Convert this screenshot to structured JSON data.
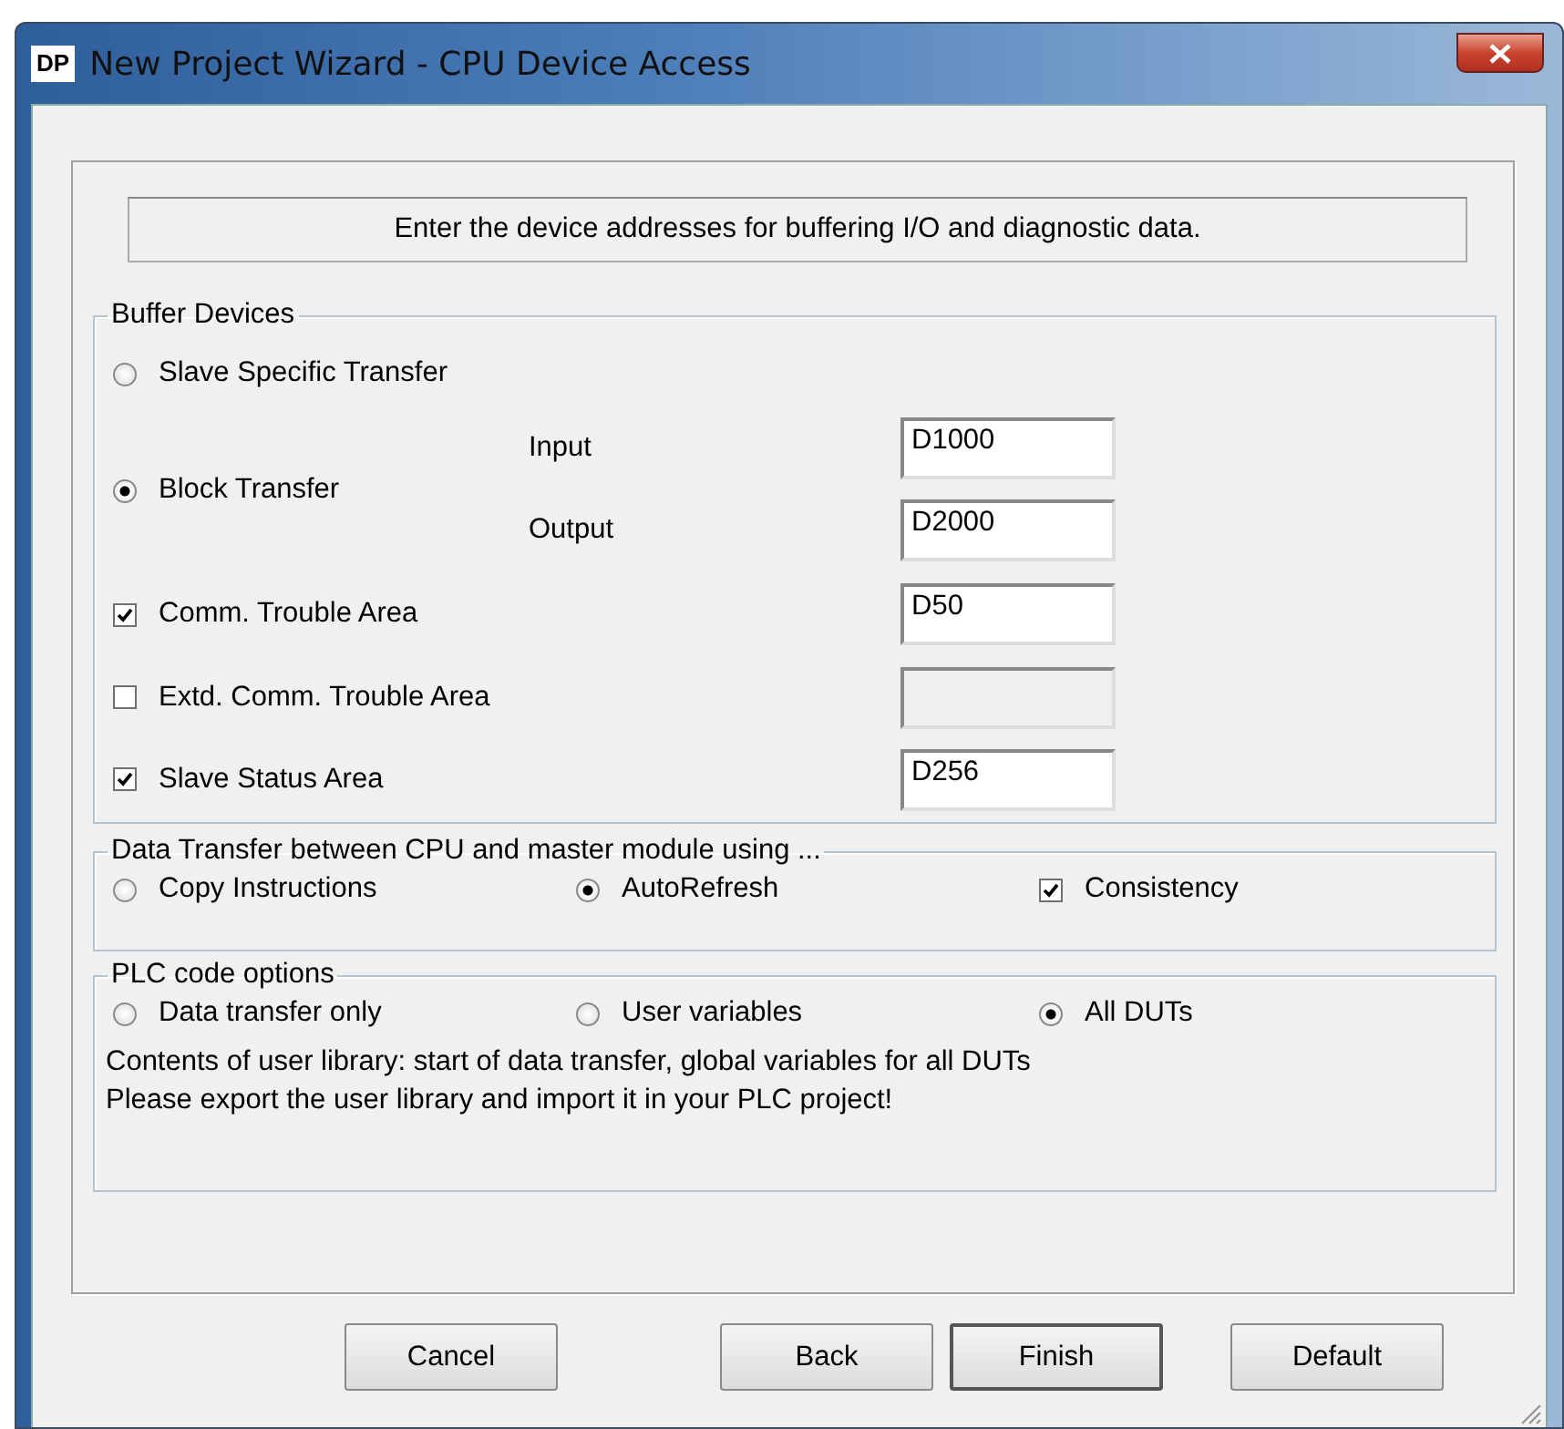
{
  "window": {
    "title": "New Project Wizard - CPU Device Access",
    "app_badge": "DP"
  },
  "instruction": "Enter the device addresses for buffering I/O and diagnostic data.",
  "buffer_devices": {
    "title": "Buffer Devices",
    "transfer_modes": [
      {
        "label": "Slave Specific Transfer",
        "selected": false
      },
      {
        "label": "Block Transfer",
        "selected": true
      }
    ],
    "block_fields": [
      {
        "label": "Input",
        "value": "D1000"
      },
      {
        "label": "Output",
        "value": "D2000"
      }
    ],
    "areas": [
      {
        "label": "Comm. Trouble Area",
        "checked": true,
        "value": "D50",
        "disabled": false
      },
      {
        "label": "Extd. Comm. Trouble Area",
        "checked": false,
        "disabled": true
      },
      {
        "label": "Slave Status Area",
        "checked": true,
        "value": "D256",
        "disabled": false
      }
    ]
  },
  "data_transfer": {
    "title": "Data Transfer between CPU and master module using ...",
    "options": [
      {
        "label": "Copy Instructions",
        "selected": false
      },
      {
        "label": "AutoRefresh",
        "selected": true
      }
    ],
    "consistency": {
      "label": "Consistency",
      "checked": true
    }
  },
  "plc_code": {
    "title": "PLC code options",
    "options": [
      {
        "label": "Data transfer only",
        "selected": false
      },
      {
        "label": "User variables",
        "selected": false
      },
      {
        "label": "All DUTs",
        "selected": true
      }
    ],
    "notes": [
      "Contents of user library: start of data transfer, global variables for all DUTs",
      "Please export the user library and import it in your PLC project!"
    ]
  },
  "buttons": [
    {
      "label": "Cancel",
      "default": false
    },
    {
      "label": "Back",
      "default": false
    },
    {
      "label": "Finish",
      "default": true
    },
    {
      "label": "Default",
      "default": false
    }
  ]
}
